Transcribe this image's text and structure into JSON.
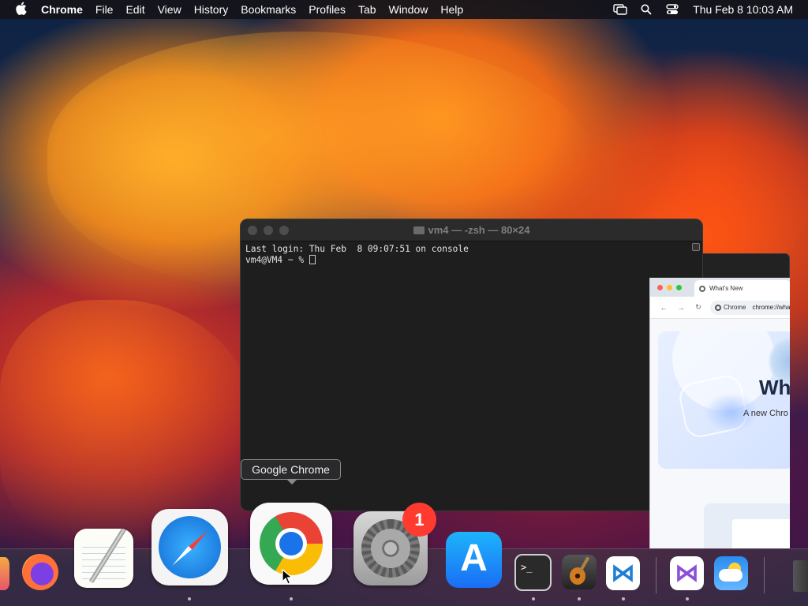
{
  "menubar": {
    "app_name": "Chrome",
    "items": [
      "File",
      "Edit",
      "View",
      "History",
      "Bookmarks",
      "Profiles",
      "Tab",
      "Window",
      "Help"
    ],
    "status_icons": [
      "screen-mirroring-icon",
      "search-icon",
      "control-center-icon"
    ],
    "clock": "Thu Feb 8  10:03 AM"
  },
  "terminal": {
    "title": "vm4 — -zsh — 80×24",
    "lines": [
      "Last login: Thu Feb  8 09:07:51 on console",
      "vm4@VM4 ~ % "
    ]
  },
  "chrome_preview": {
    "tab_title": "What's New",
    "chip_label": "Chrome",
    "url": "chrome://what",
    "heading_partial": "Wh",
    "sub_partial": "A new Chro"
  },
  "tooltip": {
    "label": "Google Chrome"
  },
  "dock": {
    "icons": [
      "launchpad-icon",
      "firefox-icon",
      "textedit-icon",
      "safari-icon",
      "chrome-icon",
      "system-settings-icon",
      "app-store-icon",
      "terminal-icon",
      "garageband-icon",
      "vscode-icon",
      "visual-studio-icon",
      "weather-icon",
      "trash-icon"
    ],
    "settings_badge": "1",
    "terminal_prompt": ">_",
    "appstore_glyph": "A",
    "vscode_glyph": "⋈",
    "vs_glyph": "⋈"
  },
  "colors": {
    "accent_blue": "#1a73e8",
    "badge_red": "#ff3b30"
  }
}
